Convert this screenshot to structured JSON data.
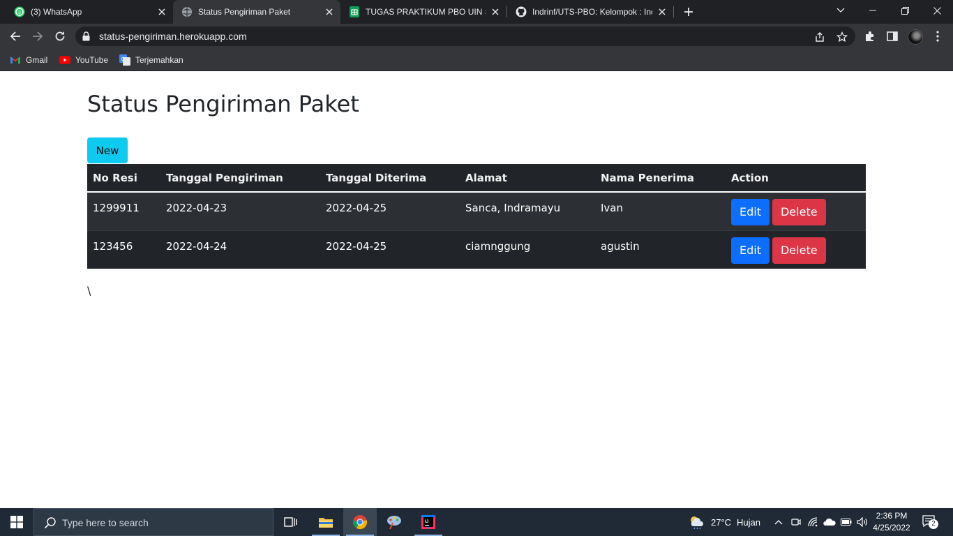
{
  "browser": {
    "tabs": [
      {
        "title": "(3) WhatsApp",
        "badge": "3"
      },
      {
        "title": "Status Pengiriman Paket"
      },
      {
        "title": "TUGAS PRAKTIKUM PBO UIN SGD"
      },
      {
        "title": "Indrinf/UTS-PBO: Kelompok : Indi"
      }
    ],
    "url": "status-pengiriman.herokuapp.com",
    "bookmarks": [
      {
        "label": "Gmail"
      },
      {
        "label": "YouTube"
      },
      {
        "label": "Terjemahkan"
      }
    ]
  },
  "page": {
    "title": "Status Pengiriman Paket",
    "new_button": "New",
    "table": {
      "headers": [
        "No Resi",
        "Tanggal Pengiriman",
        "Tanggal Diterima",
        "Alamat",
        "Nama Penerima",
        "Action"
      ],
      "rows": [
        {
          "no_resi": "1299911",
          "tanggal_pengiriman": "2022-04-23",
          "tanggal_diterima": "2022-04-25",
          "alamat": "Sanca, Indramayu",
          "nama_penerima": "Ivan",
          "edit": "Edit",
          "delete": "Delete"
        },
        {
          "no_resi": "123456",
          "tanggal_pengiriman": "2022-04-24",
          "tanggal_diterima": "2022-04-25",
          "alamat": "ciamnggung",
          "nama_penerima": "agustin",
          "edit": "Edit",
          "delete": "Delete"
        }
      ]
    },
    "stray_text": "\\"
  },
  "taskbar": {
    "search_placeholder": "Type here to search",
    "weather": {
      "temp": "27°C",
      "condition": "Hujan"
    },
    "time": "2:36 PM",
    "date": "4/25/2022",
    "notification_count": "2"
  },
  "colors": {
    "primary": "#0d6efd",
    "danger": "#dc3545",
    "info": "#0dcaf0",
    "table_dark": "#212529"
  }
}
